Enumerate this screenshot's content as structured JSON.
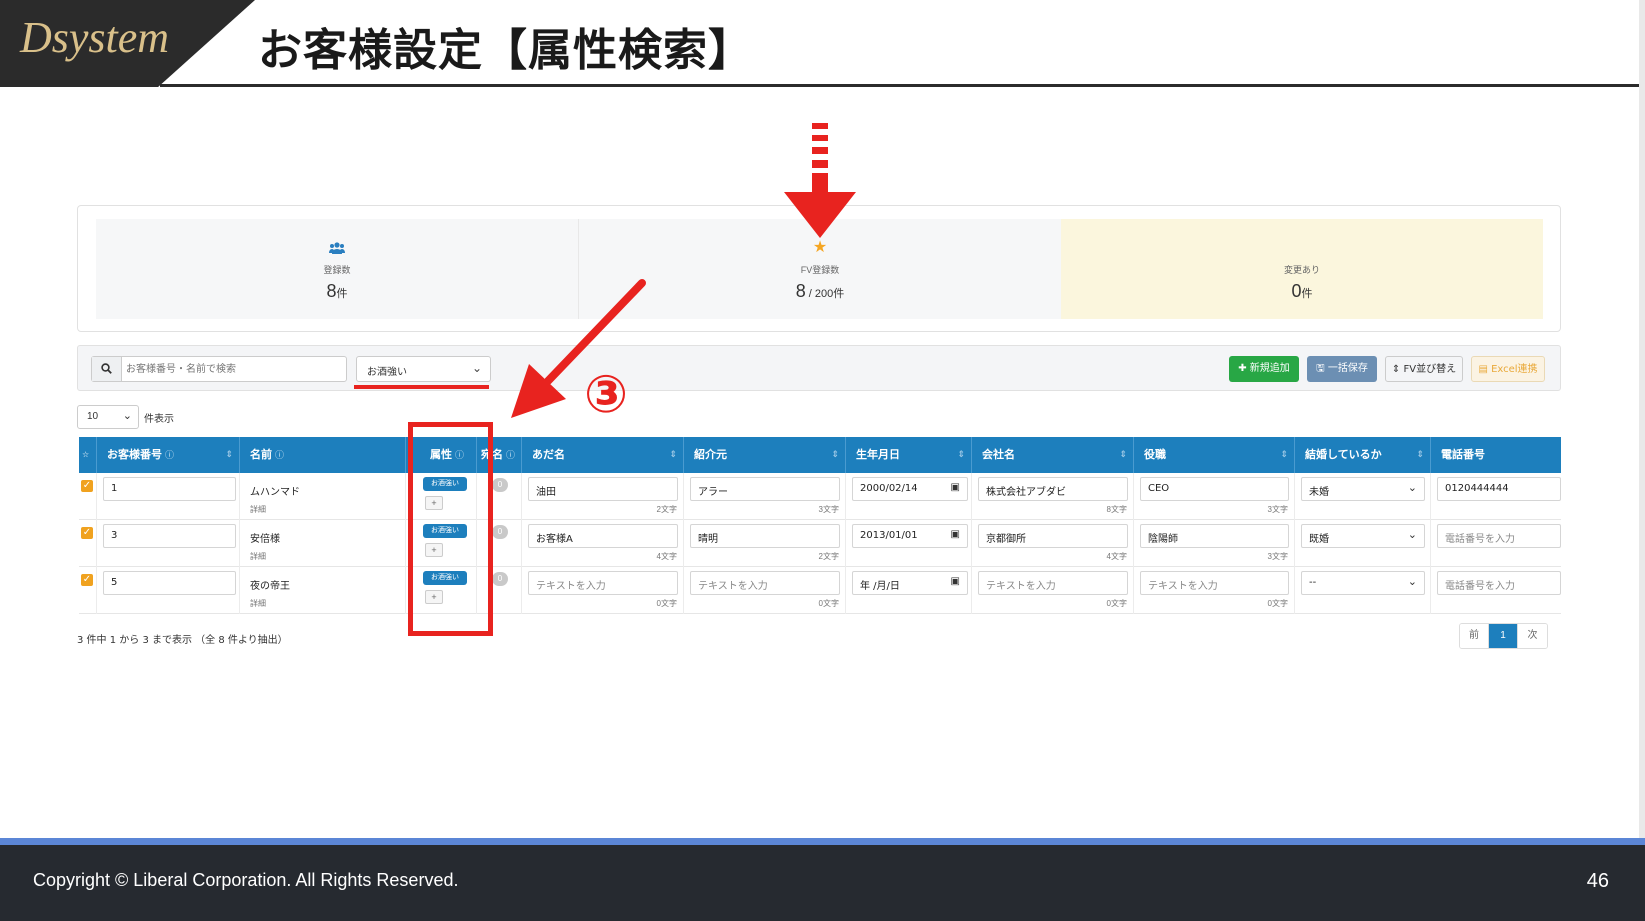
{
  "slide": {
    "logo": "Dsystem",
    "title": "お客様設定【属性検索】",
    "copyright": "Copyright ©  Liberal Corporation. All Rights Reserved.",
    "page_number": "46"
  },
  "stats": [
    {
      "icon": "users-icon",
      "label": "登録数",
      "value": "8",
      "unit": "件"
    },
    {
      "icon": "star-icon",
      "label": "FV登録数",
      "value": "8",
      "unit": " / 200件"
    },
    {
      "icon": "",
      "label": "変更あり",
      "value": "0",
      "unit": "件"
    }
  ],
  "toolbar": {
    "search_placeholder": "お客様番号・名前で検索",
    "attribute_filter": "お酒強い",
    "btn_add": "✚ 新規追加",
    "btn_save": "🖫 一括保存",
    "btn_fv": "⇕ FV並び替え",
    "btn_excel": "▤ Excel連携"
  },
  "page_size": {
    "value": "10",
    "label": "件表示"
  },
  "table": {
    "headers": [
      "お客様番号",
      "名前",
      "属性",
      "宛名",
      "あだ名",
      "紹介元",
      "生年月日",
      "会社名",
      "役職",
      "結婚しているか",
      "電話番号"
    ],
    "rows": [
      {
        "id": "1",
        "name": "ムハンマド",
        "detail": "詳細",
        "tag": "お酒強い",
        "nickname": "油田",
        "nickname_count": "2文字",
        "referrer": "アラー",
        "referrer_count": "3文字",
        "birthday": "2000/02/14",
        "company": "株式会社アブダビ",
        "company_count": "8文字",
        "position": "CEO",
        "position_count": "3文字",
        "married": "未婚",
        "phone": "0120444444"
      },
      {
        "id": "3",
        "name": "安倍様",
        "detail": "詳細",
        "tag": "お酒強い",
        "nickname": "お客様A",
        "nickname_count": "4文字",
        "referrer": "晴明",
        "referrer_count": "2文字",
        "birthday": "2013/01/01",
        "company": "京都御所",
        "company_count": "4文字",
        "position": "陰陽師",
        "position_count": "3文字",
        "married": "既婚",
        "phone": "電話番号を入力"
      },
      {
        "id": "5",
        "name": "夜の帝王",
        "detail": "詳細",
        "tag": "お酒強い",
        "nickname": "テキストを入力",
        "nickname_count": "0文字",
        "referrer": "テキストを入力",
        "referrer_count": "0文字",
        "birthday": "年 /月/日",
        "company": "テキストを入力",
        "company_count": "0文字",
        "position": "テキストを入力",
        "position_count": "0文字",
        "married": "--",
        "phone": "電話番号を入力"
      }
    ],
    "zero_badge": "0",
    "plus": "+"
  },
  "summary": "3 件中 1 から 3 まで表示 （全 8 件より抽出）",
  "pager": {
    "prev": "前",
    "current": "1",
    "next": "次"
  },
  "annotation": {
    "number": "③"
  },
  "colors": {
    "header_blue": "#1d7fbd",
    "annotation_red": "#e8231f",
    "footer_bg": "#262a30",
    "footer_line": "#5b86d6"
  }
}
